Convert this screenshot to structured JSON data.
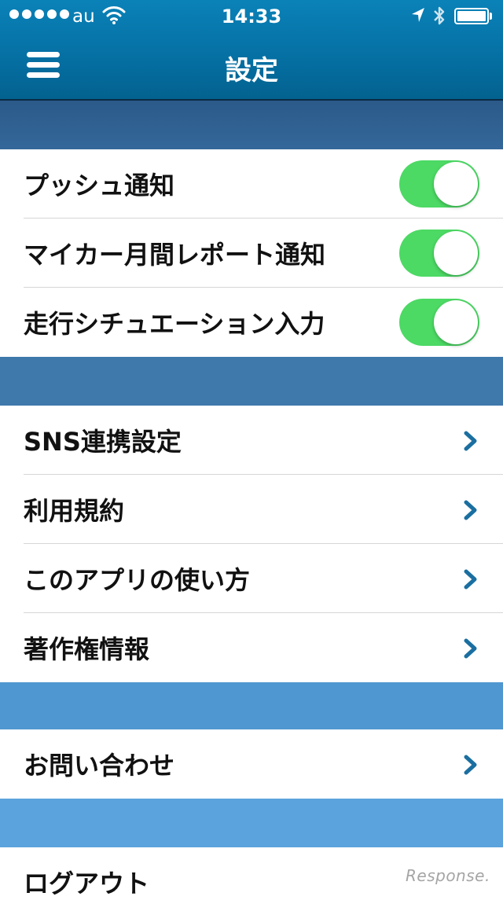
{
  "status_bar": {
    "carrier": "au",
    "time": "14:33",
    "signal_bars": 5,
    "battery_level": 1.0,
    "icons": [
      "signal-dots-icon",
      "wifi-icon",
      "location-arrow-icon",
      "bluetooth-icon",
      "battery-icon"
    ]
  },
  "header": {
    "title": "設定",
    "menu_icon": "hamburger-menu-icon"
  },
  "colors": {
    "header": "#056fa2",
    "band_1": "#2f5f8e",
    "band_2": "#3f78ab",
    "band_3": "#4f97d0",
    "band_4": "#5aa3dc",
    "toggle_on": "#4cd964",
    "chevron": "#1a6fa0"
  },
  "toggles": [
    {
      "label": "プッシュ通知",
      "on": true
    },
    {
      "label": "マイカー月間レポート通知",
      "on": true
    },
    {
      "label": "走行シチュエーション入力",
      "on": true
    }
  ],
  "links_group_1": [
    {
      "label": "SNS連携設定",
      "icon": "chevron-right-icon"
    },
    {
      "label": "利用規約",
      "icon": "chevron-right-icon"
    },
    {
      "label": "このアプリの使い方",
      "icon": "chevron-right-icon"
    },
    {
      "label": "著作権情報",
      "icon": "chevron-right-icon"
    }
  ],
  "links_group_2": [
    {
      "label": "お問い合わせ",
      "icon": "chevron-right-icon"
    }
  ],
  "logout": {
    "label": "ログアウト"
  },
  "watermark": "Response."
}
